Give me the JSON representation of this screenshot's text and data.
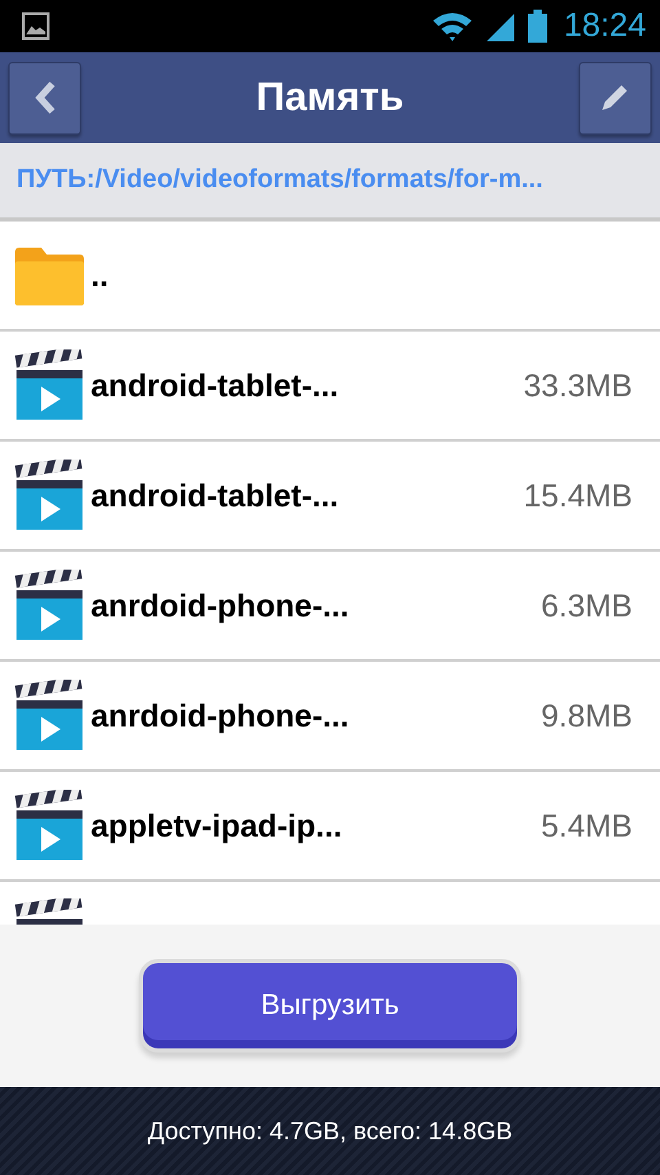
{
  "status_bar": {
    "time": "18:24"
  },
  "header": {
    "title": "Память"
  },
  "path": "ПУТЬ:/Video/videoformats/formats/for-m...",
  "files": [
    {
      "kind": "folder",
      "name": ".."
    },
    {
      "kind": "video",
      "name": "android-tablet-...",
      "size": "33.3MB"
    },
    {
      "kind": "video",
      "name": "android-tablet-...",
      "size": "15.4MB"
    },
    {
      "kind": "video",
      "name": "anrdoid-phone-...",
      "size": "6.3MB"
    },
    {
      "kind": "video",
      "name": "anrdoid-phone-...",
      "size": "9.8MB"
    },
    {
      "kind": "video",
      "name": "appletv-ipad-ip...",
      "size": "5.4MB"
    },
    {
      "kind": "video"
    }
  ],
  "upload_button": "Выгрузить",
  "footer": "Доступно: 4.7GB, всего: 14.8GB"
}
